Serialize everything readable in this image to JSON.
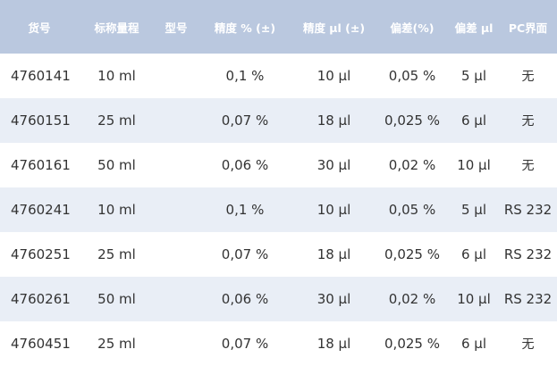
{
  "table": {
    "headers": [
      "货号",
      "标称量程",
      "型号",
      "精度 % (±)",
      "精度 µl (±)",
      "偏差(%)",
      "偏差 µl",
      "PC界面"
    ],
    "rows": [
      [
        "4760141",
        "10 ml",
        "",
        "0,1 %",
        "10 µl",
        "0,05 %",
        "5 µl",
        "无"
      ],
      [
        "4760151",
        "25 ml",
        "",
        "0,07 %",
        "18 µl",
        "0,025 %",
        "6 µl",
        "无"
      ],
      [
        "4760161",
        "50 ml",
        "",
        "0,06 %",
        "30 µl",
        "0,02 %",
        "10 µl",
        "无"
      ],
      [
        "4760241",
        "10 ml",
        "",
        "0,1 %",
        "10 µl",
        "0,05 %",
        "5 µl",
        "RS 232"
      ],
      [
        "4760251",
        "25 ml",
        "",
        "0,07 %",
        "18 µl",
        "0,025 %",
        "6 µl",
        "RS 232"
      ],
      [
        "4760261",
        "50 ml",
        "",
        "0,06 %",
        "30 µl",
        "0,02 %",
        "10 µl",
        "RS 232"
      ],
      [
        "4760451",
        "25 ml",
        "",
        "0,07 %",
        "18 µl",
        "0,025 %",
        "6 µl",
        "无"
      ]
    ]
  },
  "colors": {
    "header_background": "#bac8df",
    "header_text": "#ffffff",
    "stripe_background": "#e9eef6",
    "body_text": "#333333"
  }
}
